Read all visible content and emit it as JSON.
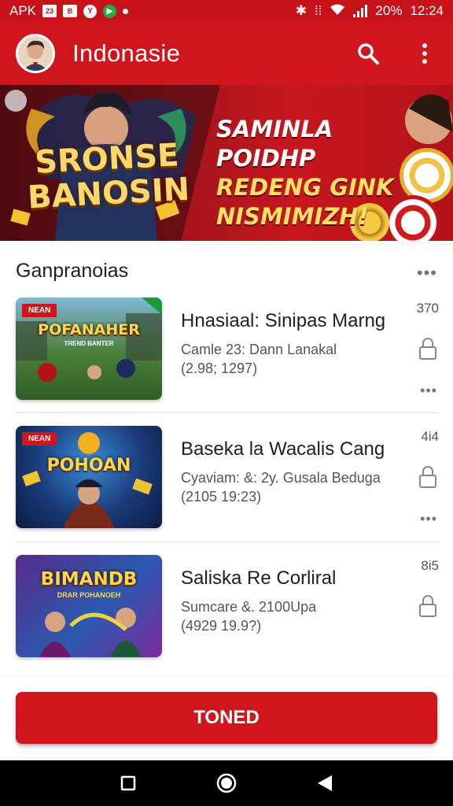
{
  "status_bar": {
    "carrier": "APK",
    "icon_box_1": "23",
    "icon_box_2": "B",
    "battery": "20%",
    "time": "12:24"
  },
  "app_bar": {
    "title": "Indonasie",
    "icons": [
      "avatar",
      "search-icon",
      "more-vert-icon"
    ]
  },
  "banner": {
    "title_line1": "SRONSE",
    "title_line2": "BANOSIN",
    "promo_line1": "SAMINLA POIDHP",
    "promo_line2": "REDENG GINK",
    "promo_line3": "NISMIMIZH!"
  },
  "section": {
    "title": "Ganpranoias"
  },
  "games": [
    {
      "badge": "NEAN",
      "thumb_title": "POFANAHER",
      "thumb_subtitle": "TREND BANTER",
      "title": "Hnasiaal: Sinipas Marng",
      "subtitle": "Camle 23: Dann Lanakal",
      "date": "(2.98; 1297)",
      "count": "370"
    },
    {
      "badge": "NEAN",
      "thumb_title": "POHOAN",
      "thumb_subtitle": "",
      "title": "Baseka la Wacalis Cang",
      "subtitle": "Cyaviam: &: 2y. Gusala Beduga",
      "date": "(2105 19:23)",
      "count": "4i4"
    },
    {
      "badge": "",
      "thumb_title": "BIMANDB",
      "thumb_subtitle": "DRAR POHANOEH",
      "title": "Saliska Re Corliral",
      "subtitle": "Sumcare &. 2100Upa",
      "date": "(4929 19.9?)",
      "count": "8i5"
    }
  ],
  "primary_button": {
    "label": "TONED"
  },
  "colors": {
    "brand_red": "#d1151d",
    "status_red": "#c8121a"
  }
}
